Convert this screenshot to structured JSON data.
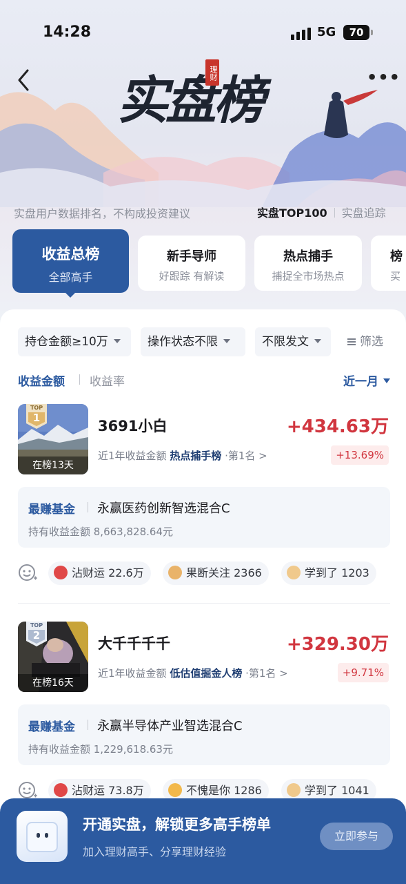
{
  "status_bar": {
    "time": "14:28",
    "network": "5G",
    "battery": "70"
  },
  "header": {
    "title": "实盘榜",
    "seal_text": "理财",
    "disclaimer": "实盘用户数据排名，不构成投资建议",
    "links": [
      {
        "label": "实盘TOP100"
      },
      {
        "label": "实盘追踪"
      }
    ]
  },
  "categories": [
    {
      "title": "收益总榜",
      "subtitle": "全部高手"
    },
    {
      "title": "新手导师",
      "subtitle": "好跟踪 有解读"
    },
    {
      "title": "热点捕手",
      "subtitle": "捕捉全市场热点"
    },
    {
      "title": "榜",
      "subtitle": "买"
    }
  ],
  "filters": {
    "chips": [
      {
        "label": "持仓金额≥10万"
      },
      {
        "label": "操作状态不限"
      },
      {
        "label": "不限发文"
      }
    ],
    "screen_label": "筛选"
  },
  "sort": {
    "by_amount": "收益金额",
    "by_rate": "收益率",
    "period": "近一月"
  },
  "entries": [
    {
      "rank_label": "TOP",
      "rank": "1",
      "days": "在榜13天",
      "name": "3691小白",
      "profit": "+434.63万",
      "sub_prefix": "近1年收益金额 ",
      "board": "热点捕手榜",
      "sub_suffix": " ·第1名 >",
      "rate": "+13.69%",
      "fund_tag": "最赚基金",
      "fund_name": "永赢医药创新智选混合C",
      "fund_hold": "持有收益金额 8,663,828.64元",
      "reactions": [
        {
          "label": "沾财运 22.6万",
          "icon": "red-lucky-icon",
          "color": "#e04848"
        },
        {
          "label": "果断关注 2366",
          "icon": "doge-icon",
          "color": "#e9b36a"
        },
        {
          "label": "学到了 1203",
          "icon": "praise-hands-icon",
          "color": "#f0c98c"
        }
      ]
    },
    {
      "rank_label": "TOP",
      "rank": "2",
      "days": "在榜16天",
      "name": "大千千千千",
      "profit": "+329.30万",
      "sub_prefix": "近1年收益金额 ",
      "board": "低估值掘金人榜",
      "sub_suffix": " ·第1名 >",
      "rate": "+9.71%",
      "fund_tag": "最赚基金",
      "fund_name": "永赢半导体产业智选混合C",
      "fund_hold": "持有收益金额 1,229,618.63元",
      "reactions": [
        {
          "label": "沾财运 73.8万",
          "icon": "red-lucky-icon",
          "color": "#e04848"
        },
        {
          "label": "不愧是你 1286",
          "icon": "thumbs-face-icon",
          "color": "#f2b84b"
        },
        {
          "label": "学到了 1041",
          "icon": "praise-hands-icon",
          "color": "#f0c98c"
        }
      ]
    }
  ],
  "banner": {
    "title": "开通实盘，解锁更多高手榜单",
    "subtitle": "加入理财高手、分享理财经验",
    "button": "立即参与"
  },
  "colors": {
    "brand": "#2c5aa0",
    "profit": "#d1363f"
  }
}
